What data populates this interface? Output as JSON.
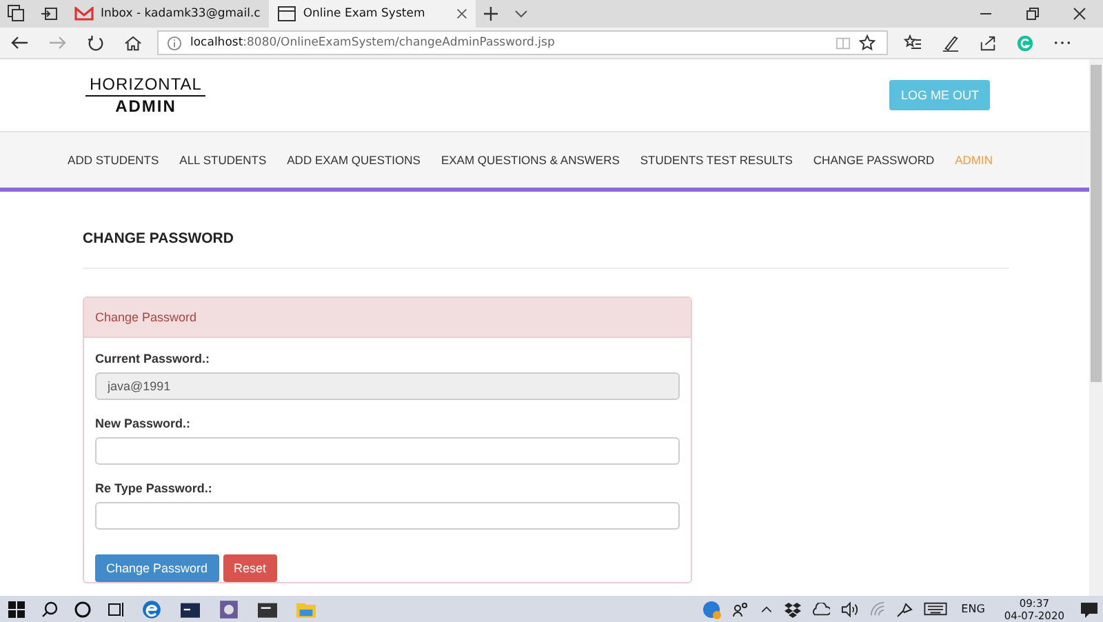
{
  "browser": {
    "tabs": [
      {
        "title": "Inbox - kadamk33@gmail.c",
        "selected": false,
        "kind": "mail"
      },
      {
        "title": "Online Exam System",
        "selected": true,
        "kind": "page"
      }
    ],
    "url_host": "localhost",
    "url_path": ":8080/OnlineExamSystem/changeAdminPassword.jsp"
  },
  "header": {
    "logo_top": "HORIZONTAL",
    "logo_bottom": "ADMIN",
    "logout_button": "LOG ME OUT"
  },
  "nav": [
    {
      "label": "ADD STUDENTS",
      "selected": false
    },
    {
      "label": "ALL STUDENTS",
      "selected": false
    },
    {
      "label": "ADD EXAM QUESTIONS",
      "selected": false
    },
    {
      "label": "EXAM QUESTIONS & ANSWERS",
      "selected": false
    },
    {
      "label": "STUDENTS TEST RESULTS",
      "selected": false
    },
    {
      "label": "CHANGE PASSWORD",
      "selected": false
    },
    {
      "label": "ADMIN",
      "selected": true
    }
  ],
  "page_title": "CHANGE PASSWORD",
  "panel": {
    "title": "Change Password",
    "fields": [
      {
        "label": "Current Password.:",
        "value": "java@1991",
        "disabled": true
      },
      {
        "label": "New Password.:",
        "disabled": false
      },
      {
        "label": "Re Type Password.:",
        "disabled": false
      }
    ],
    "buttons": [
      {
        "label": "Change Password",
        "kind": "primary"
      },
      {
        "label": "Reset",
        "kind": "danger"
      }
    ]
  },
  "taskbar": {
    "language": "ENG",
    "time": "09:37",
    "date": "04-07-2020"
  }
}
